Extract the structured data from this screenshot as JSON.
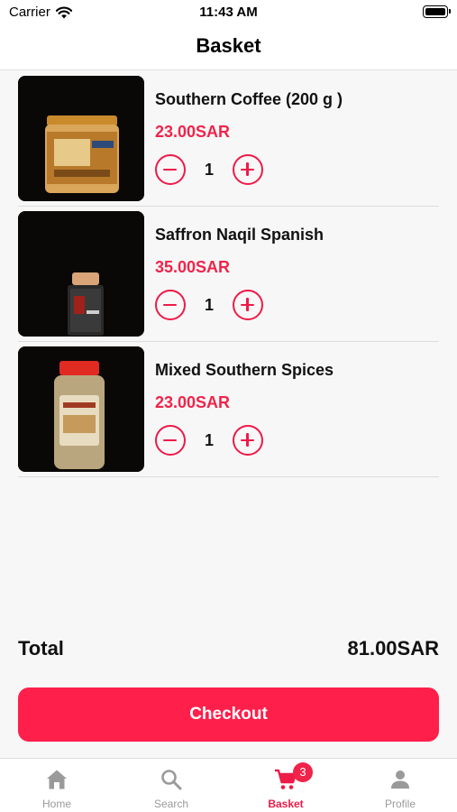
{
  "status_bar": {
    "carrier": "Carrier",
    "time": "11:43 AM"
  },
  "header": {
    "title": "Basket"
  },
  "basket": {
    "items": [
      {
        "name": "Southern Coffee (200 g )",
        "price": "23.00SAR",
        "quantity": "1"
      },
      {
        "name": "Saffron Naqil Spanish",
        "price": "35.00SAR",
        "quantity": "1"
      },
      {
        "name": "Mixed Southern Spices",
        "price": "23.00SAR",
        "quantity": "1"
      }
    ]
  },
  "summary": {
    "total_label": "Total",
    "total_value": "81.00SAR"
  },
  "checkout": {
    "label": "Checkout"
  },
  "tab_bar": {
    "tabs": [
      {
        "label": "Home",
        "icon": "home-icon"
      },
      {
        "label": "Search",
        "icon": "search-icon"
      },
      {
        "label": "Basket",
        "icon": "cart-icon",
        "badge": "3",
        "active": true
      },
      {
        "label": "Profile",
        "icon": "person-icon"
      }
    ]
  },
  "colors": {
    "accent": "#ff1f4b",
    "price": "#f0244a",
    "inactive_tab": "#9a9a9a"
  }
}
